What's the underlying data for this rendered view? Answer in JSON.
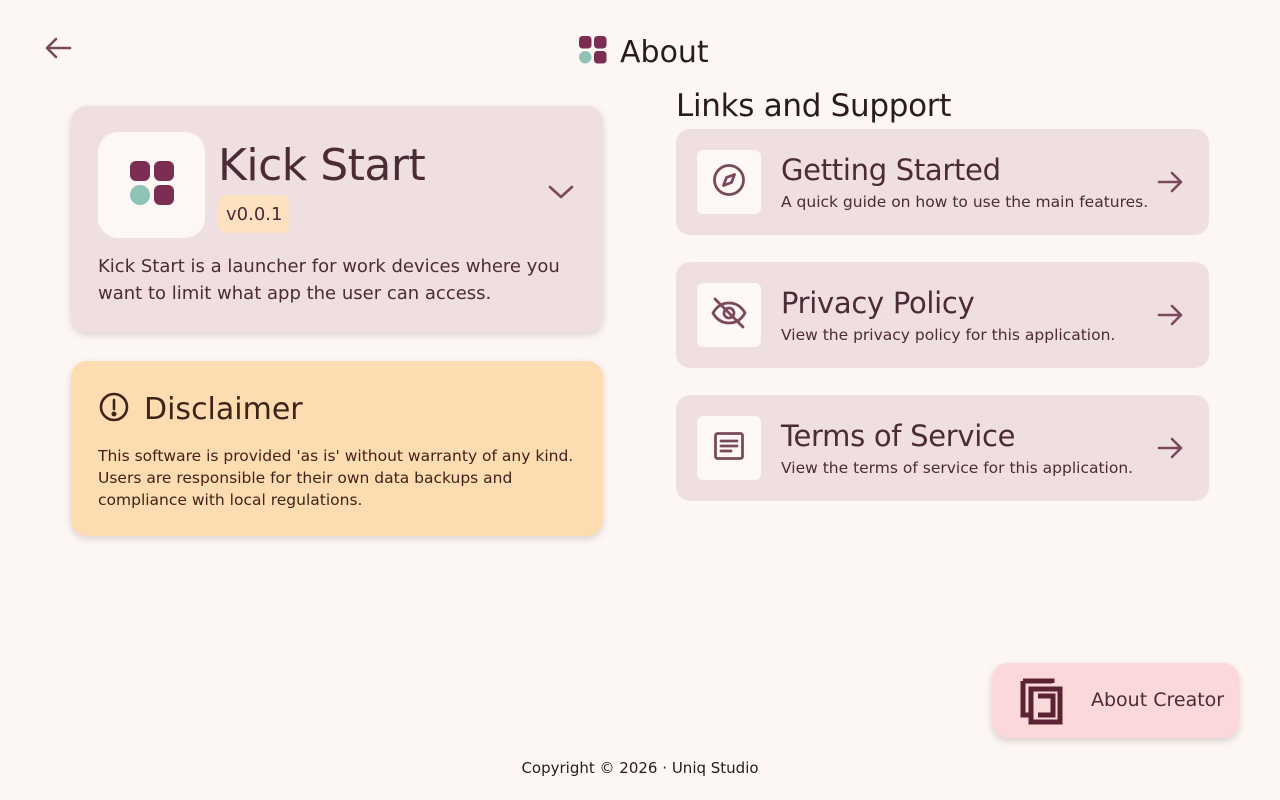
{
  "header": {
    "title": "About",
    "back_icon": "arrow-left-icon",
    "logo_icon": "app-logo-icon"
  },
  "app_card": {
    "name": "Kick Start",
    "version": "v0.0.1",
    "description": "Kick Start is a launcher for work devices where you want to limit what app the user can access.",
    "expand_icon": "chevron-down-icon"
  },
  "disclaimer": {
    "title": "Disclaimer",
    "icon": "alert-circle-icon",
    "text": "This software is provided 'as is' without warranty of any kind. Users are responsible for their own data backups and compliance with local regulations."
  },
  "links": {
    "section_title": "Links and Support",
    "items": [
      {
        "title": "Getting Started",
        "subtitle": "A quick guide on how to use the main features.",
        "icon": "compass-icon"
      },
      {
        "title": "Privacy Policy",
        "subtitle": "View the privacy policy for this application.",
        "icon": "eye-off-icon"
      },
      {
        "title": "Terms of Service",
        "subtitle": "View the terms of service for this application.",
        "icon": "article-icon"
      }
    ]
  },
  "creator": {
    "label": "About Creator",
    "icon": "studio-logo-icon"
  },
  "footer": {
    "prefix": "Copyright ©",
    "year": "2026",
    "separator": "·",
    "company": "Uniq Studio"
  },
  "colors": {
    "background": "#fdf7f4",
    "card": "#f0dfe0",
    "disclaimer": "#fddcb1",
    "badge": "#fde1c1",
    "creator_button": "#fbd8da",
    "accent": "#7b2d52",
    "teal": "#8fc3b5",
    "text_primary": "#4a2b36"
  }
}
